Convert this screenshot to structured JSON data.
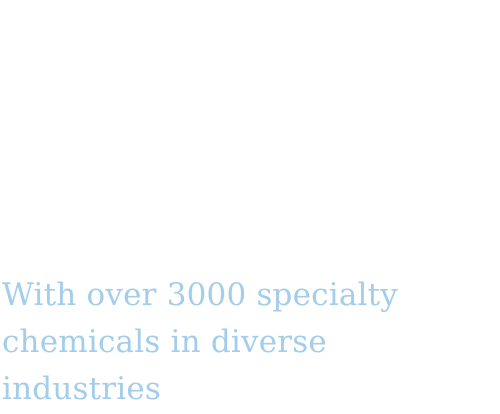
{
  "tagline": {
    "text": "With over 3000 specialty chemicals in diverse industries",
    "color": "#a3cdea"
  }
}
